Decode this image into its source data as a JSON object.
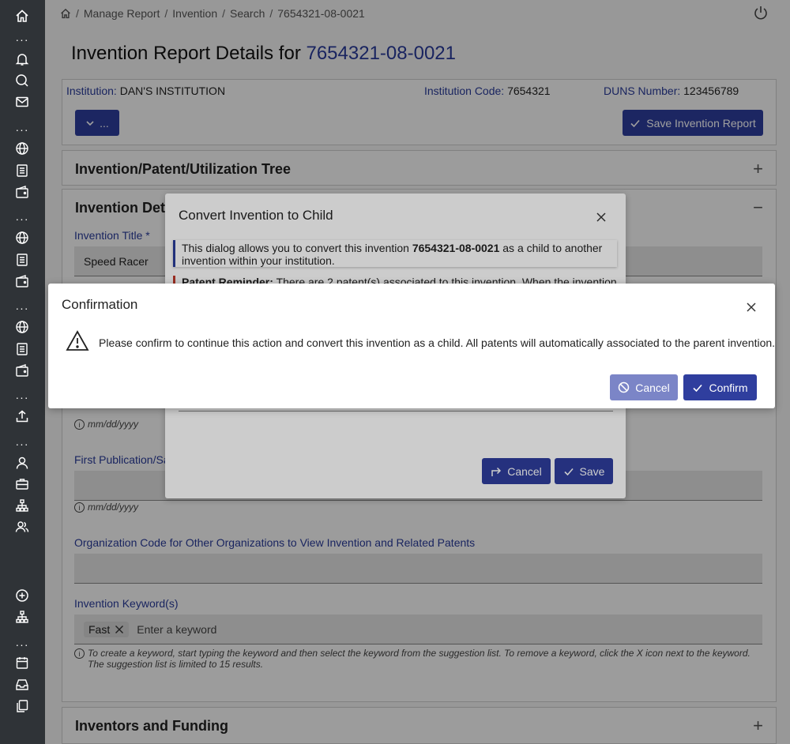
{
  "rail": {
    "dots": "···"
  },
  "breadcrumb": {
    "items": [
      "Manage Report",
      "Invention",
      "Search",
      "7654321-08-0021"
    ],
    "separator": "/"
  },
  "header": {
    "title_prefix": "Invention Report Details for",
    "title_number": "7654321-08-0021"
  },
  "info": {
    "institution_label": "Institution:",
    "institution_value": "DAN'S INSTITUTION",
    "code_label": "Institution Code:",
    "code_value": "7654321",
    "duns_label": "DUNS Number:",
    "duns_value": "123456789",
    "dropdown_label": "...",
    "save_label": "Save Invention Report"
  },
  "panels": {
    "tree_title": "Invention/Patent/Utilization Tree",
    "details_title": "Invention Detai",
    "inventors_title": "Inventors and Funding",
    "expand": "+",
    "collapse": "−"
  },
  "form": {
    "title_label": "Invention Title *",
    "title_value": "Speed Racer",
    "date_hint": "mm/dd/yyyy",
    "pub_label": "First Publication/Sa",
    "org_label": "Organization Code for Other Organizations to View Invention and Related Patents",
    "keyword_label": "Invention Keyword(s)",
    "keyword_chip": "Fast",
    "keyword_placeholder": "Enter a keyword",
    "keyword_hint": "To create a keyword, start typing the keyword and then select the keyword from the suggestion list. To remove a keyword, click the X icon next to the keyword. The suggestion list is limited to 15 results."
  },
  "convert_dialog": {
    "title": "Convert Invention to Child",
    "note_pre": "This dialog allows you to convert this invention",
    "note_bold": "7654321-08-0021",
    "note_post": "as a child to another invention within your institution.",
    "reminder_bold": "Patent Reminder:",
    "reminder_text": "There are 2 patent(s) associated to this invention. When the invention",
    "cancel_label": "Cancel",
    "save_label": "Save"
  },
  "confirmation": {
    "title": "Confirmation",
    "message": "Please confirm to continue this action and convert this invention as a child. All patents will automatically associated to the parent invention.",
    "cancel_label": "Cancel",
    "confirm_label": "Confirm"
  },
  "colors": {
    "primary": "#2f3e9e",
    "rail": "#2f3337",
    "link": "#2a3c9a"
  }
}
